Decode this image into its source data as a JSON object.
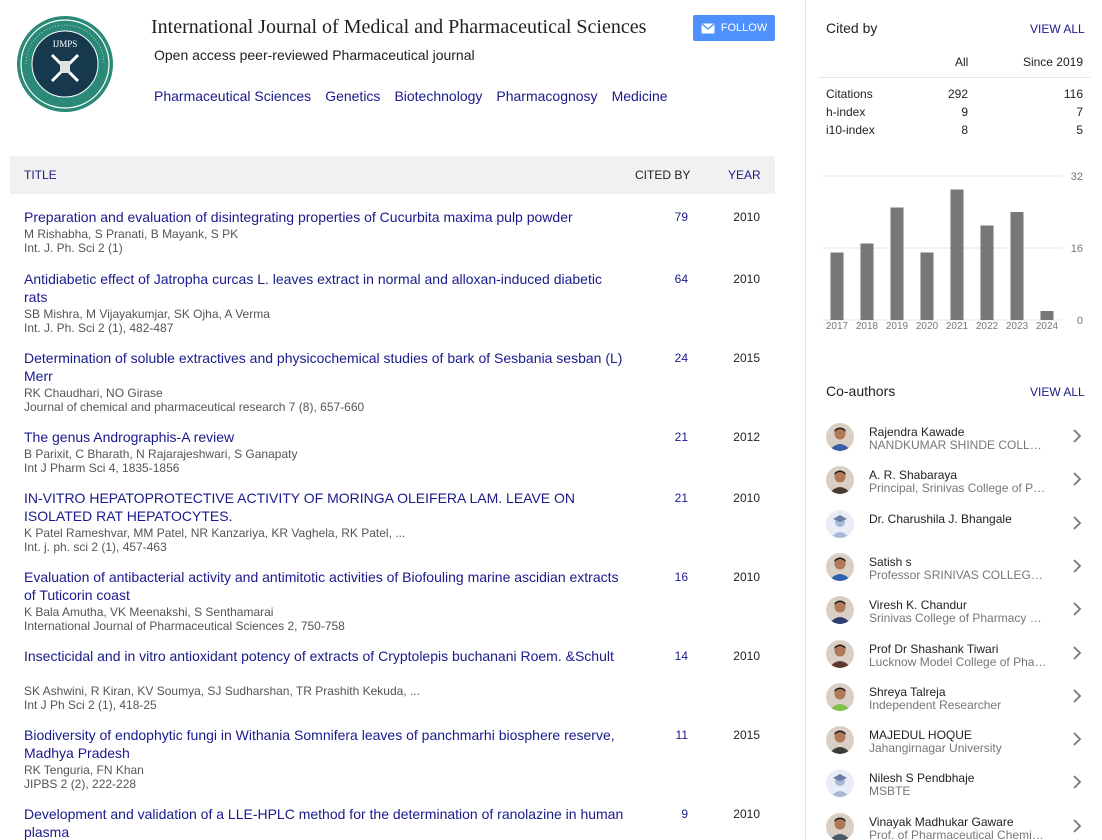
{
  "header": {
    "logo_text": "IJMPS",
    "title": "International Journal of Medical and Pharmaceutical Sciences",
    "subtitle": "Open access peer-reviewed Pharmaceutical journal",
    "follow_label": "FOLLOW",
    "tags": [
      "Pharmaceutical Sciences",
      "Genetics",
      "Biotechnology",
      "Pharmacognosy",
      "Medicine"
    ]
  },
  "table": {
    "col_title": "TITLE",
    "col_cited": "CITED BY",
    "col_year": "YEAR",
    "rows": [
      {
        "title": "Preparation and evaluation of disintegrating properties of Cucurbita maxima pulp powder",
        "authors": "M Rishabha, S Pranati, B Mayank, S PK",
        "source": "Int. J. Ph. Sci 2 (1)",
        "cited": "79",
        "year": "2010"
      },
      {
        "title": "Antidiabetic effect of Jatropha curcas L. leaves extract in normal and alloxan-induced diabetic rats",
        "authors": "SB Mishra, M Vijayakumjar, SK Ojha, A Verma",
        "source": "Int. J. Ph. Sci 2 (1), 482-487",
        "cited": "64",
        "year": "2010"
      },
      {
        "title": "Determination of soluble extractives and physicochemical studies of bark of Sesbania sesban (L) Merr",
        "authors": "RK Chaudhari, NO Girase",
        "source": "Journal of chemical and pharmaceutical research 7 (8), 657-660",
        "cited": "24",
        "year": "2015"
      },
      {
        "title": "The genus Andrographis-A review",
        "authors": "B Parixit, C Bharath, N Rajarajeshwari, S Ganapaty",
        "source": "Int J Pharm Sci 4, 1835-1856",
        "cited": "21",
        "year": "2012"
      },
      {
        "title": "IN-VITRO HEPATOPROTECTIVE ACTIVITY OF MORINGA OLEIFERA LAM. LEAVE ON ISOLATED RAT HEPATOCYTES.",
        "authors": "K Patel Rameshvar, MM Patel, NR Kanzariya, KR Vaghela, RK Patel, ...",
        "source": "Int. j. ph. sci 2 (1), 457-463",
        "cited": "21",
        "year": "2010"
      },
      {
        "title": "Evaluation of antibacterial activity and antimitotic activities of Biofouling marine ascidian extracts of Tuticorin coast",
        "authors": "K Bala Amutha, VK Meenakshi, S Senthamarai",
        "source": "International Journal of Pharmaceutical Sciences 2, 750-758",
        "cited": "16",
        "year": "2010"
      },
      {
        "title": "Insecticidal and in vitro antioxidant potency of extracts of Cryptolepis buchanani Roem. &Schult",
        "authors": "SK Ashwini, R Kiran, KV Soumya, SJ Sudharshan, TR Prashith Kekuda, ...",
        "source": "Int J Ph Sci 2 (1), 418-25",
        "cited": "14",
        "year": "2010"
      },
      {
        "title": "Biodiversity of endophytic fungi in Withania Somnifera leaves of panchmarhi biosphere reserve, Madhya Pradesh",
        "authors": "RK Tenguria, FN Khan",
        "source": "JIPBS 2 (2), 222-228",
        "cited": "11",
        "year": "2015"
      },
      {
        "title": "Development and validation of a LLE-HPLC method for the determination of ranolazine in human plasma",
        "authors": "",
        "source": "",
        "cited": "9",
        "year": "2010"
      }
    ]
  },
  "cited_by": {
    "title": "Cited by",
    "view_all": "VIEW ALL",
    "col_all": "All",
    "col_since": "Since 2019",
    "rows": [
      {
        "label": "Citations",
        "all": "292",
        "since": "116"
      },
      {
        "label": "h-index",
        "all": "9",
        "since": "7"
      },
      {
        "label": "i10-index",
        "all": "8",
        "since": "5"
      }
    ]
  },
  "chart_data": {
    "type": "bar",
    "categories": [
      "2017",
      "2018",
      "2019",
      "2020",
      "2021",
      "2022",
      "2023",
      "2024"
    ],
    "values": [
      15,
      17,
      25,
      15,
      29,
      21,
      24,
      2
    ],
    "ylim": [
      0,
      32
    ],
    "yticks": [
      "32",
      "16",
      "0"
    ],
    "bar_color": "#777777"
  },
  "coauthors": {
    "title": "Co-authors",
    "view_all": "VIEW ALL",
    "items": [
      {
        "name": "Rajendra Kawade",
        "affil": "NANDKUMAR SHINDE COLLEGE OF PHARMACY",
        "avatar": "photo",
        "color": "#3a5da8"
      },
      {
        "name": "A. R. Shabaraya",
        "affil": "Principal, Srinivas College of Pharmacy",
        "avatar": "photo",
        "color": "#4a3a30"
      },
      {
        "name": "Dr. Charushila J. Bhangale",
        "affil": "",
        "avatar": "default",
        "color": "#a9b7d6"
      },
      {
        "name": "Satish s",
        "affil": "Professor SRINIVAS COLLEGE OF PHARMACY",
        "avatar": "photo",
        "color": "#2f5fb0"
      },
      {
        "name": "Viresh K. Chandur",
        "affil": "Srinivas College of Pharmacy Mangalore",
        "avatar": "photo",
        "color": "#2c3e6e"
      },
      {
        "name": "Prof Dr Shashank Tiwari",
        "affil": "Lucknow Model College of Pharmacy",
        "avatar": "photo",
        "color": "#5a3a2a"
      },
      {
        "name": "Shreya Talreja",
        "affil": "Independent Researcher",
        "avatar": "photo",
        "color": "#7fbf4a"
      },
      {
        "name": "MAJEDUL HOQUE",
        "affil": "Jahangirnagar University",
        "avatar": "photo",
        "color": "#3c3c3c"
      },
      {
        "name": "Nilesh S Pendbhaje",
        "affil": "MSBTE",
        "avatar": "default",
        "color": "#a9b7d6"
      },
      {
        "name": "Vinayak Madhukar Gaware",
        "affil": "Prof. of Pharmaceutical Chemistry",
        "avatar": "photo",
        "color": "#4a5a6a"
      }
    ]
  }
}
